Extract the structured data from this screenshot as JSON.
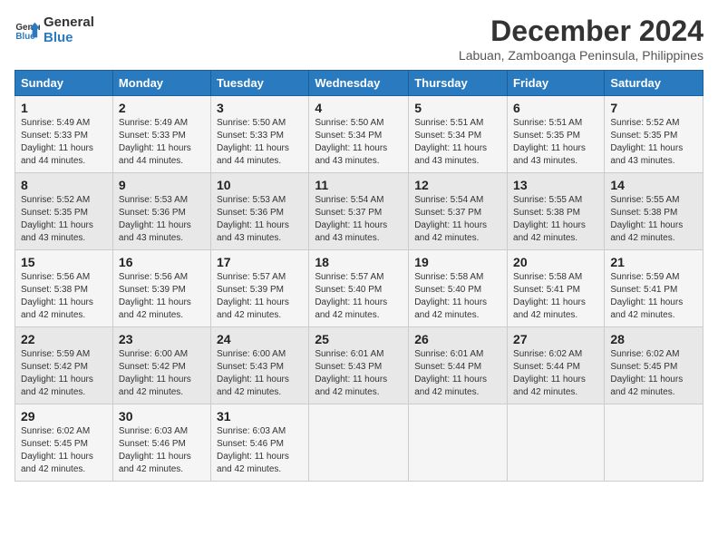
{
  "logo": {
    "line1": "General",
    "line2": "Blue"
  },
  "title": "December 2024",
  "subtitle": "Labuan, Zamboanga Peninsula, Philippines",
  "days_of_week": [
    "Sunday",
    "Monday",
    "Tuesday",
    "Wednesday",
    "Thursday",
    "Friday",
    "Saturday"
  ],
  "weeks": [
    [
      {
        "day": "1",
        "sunrise": "5:49 AM",
        "sunset": "5:33 PM",
        "daylight": "11 hours and 44 minutes."
      },
      {
        "day": "2",
        "sunrise": "5:49 AM",
        "sunset": "5:33 PM",
        "daylight": "11 hours and 44 minutes."
      },
      {
        "day": "3",
        "sunrise": "5:50 AM",
        "sunset": "5:33 PM",
        "daylight": "11 hours and 44 minutes."
      },
      {
        "day": "4",
        "sunrise": "5:50 AM",
        "sunset": "5:34 PM",
        "daylight": "11 hours and 43 minutes."
      },
      {
        "day": "5",
        "sunrise": "5:51 AM",
        "sunset": "5:34 PM",
        "daylight": "11 hours and 43 minutes."
      },
      {
        "day": "6",
        "sunrise": "5:51 AM",
        "sunset": "5:35 PM",
        "daylight": "11 hours and 43 minutes."
      },
      {
        "day": "7",
        "sunrise": "5:52 AM",
        "sunset": "5:35 PM",
        "daylight": "11 hours and 43 minutes."
      }
    ],
    [
      {
        "day": "8",
        "sunrise": "5:52 AM",
        "sunset": "5:35 PM",
        "daylight": "11 hours and 43 minutes."
      },
      {
        "day": "9",
        "sunrise": "5:53 AM",
        "sunset": "5:36 PM",
        "daylight": "11 hours and 43 minutes."
      },
      {
        "day": "10",
        "sunrise": "5:53 AM",
        "sunset": "5:36 PM",
        "daylight": "11 hours and 43 minutes."
      },
      {
        "day": "11",
        "sunrise": "5:54 AM",
        "sunset": "5:37 PM",
        "daylight": "11 hours and 43 minutes."
      },
      {
        "day": "12",
        "sunrise": "5:54 AM",
        "sunset": "5:37 PM",
        "daylight": "11 hours and 42 minutes."
      },
      {
        "day": "13",
        "sunrise": "5:55 AM",
        "sunset": "5:38 PM",
        "daylight": "11 hours and 42 minutes."
      },
      {
        "day": "14",
        "sunrise": "5:55 AM",
        "sunset": "5:38 PM",
        "daylight": "11 hours and 42 minutes."
      }
    ],
    [
      {
        "day": "15",
        "sunrise": "5:56 AM",
        "sunset": "5:38 PM",
        "daylight": "11 hours and 42 minutes."
      },
      {
        "day": "16",
        "sunrise": "5:56 AM",
        "sunset": "5:39 PM",
        "daylight": "11 hours and 42 minutes."
      },
      {
        "day": "17",
        "sunrise": "5:57 AM",
        "sunset": "5:39 PM",
        "daylight": "11 hours and 42 minutes."
      },
      {
        "day": "18",
        "sunrise": "5:57 AM",
        "sunset": "5:40 PM",
        "daylight": "11 hours and 42 minutes."
      },
      {
        "day": "19",
        "sunrise": "5:58 AM",
        "sunset": "5:40 PM",
        "daylight": "11 hours and 42 minutes."
      },
      {
        "day": "20",
        "sunrise": "5:58 AM",
        "sunset": "5:41 PM",
        "daylight": "11 hours and 42 minutes."
      },
      {
        "day": "21",
        "sunrise": "5:59 AM",
        "sunset": "5:41 PM",
        "daylight": "11 hours and 42 minutes."
      }
    ],
    [
      {
        "day": "22",
        "sunrise": "5:59 AM",
        "sunset": "5:42 PM",
        "daylight": "11 hours and 42 minutes."
      },
      {
        "day": "23",
        "sunrise": "6:00 AM",
        "sunset": "5:42 PM",
        "daylight": "11 hours and 42 minutes."
      },
      {
        "day": "24",
        "sunrise": "6:00 AM",
        "sunset": "5:43 PM",
        "daylight": "11 hours and 42 minutes."
      },
      {
        "day": "25",
        "sunrise": "6:01 AM",
        "sunset": "5:43 PM",
        "daylight": "11 hours and 42 minutes."
      },
      {
        "day": "26",
        "sunrise": "6:01 AM",
        "sunset": "5:44 PM",
        "daylight": "11 hours and 42 minutes."
      },
      {
        "day": "27",
        "sunrise": "6:02 AM",
        "sunset": "5:44 PM",
        "daylight": "11 hours and 42 minutes."
      },
      {
        "day": "28",
        "sunrise": "6:02 AM",
        "sunset": "5:45 PM",
        "daylight": "11 hours and 42 minutes."
      }
    ],
    [
      {
        "day": "29",
        "sunrise": "6:02 AM",
        "sunset": "5:45 PM",
        "daylight": "11 hours and 42 minutes."
      },
      {
        "day": "30",
        "sunrise": "6:03 AM",
        "sunset": "5:46 PM",
        "daylight": "11 hours and 42 minutes."
      },
      {
        "day": "31",
        "sunrise": "6:03 AM",
        "sunset": "5:46 PM",
        "daylight": "11 hours and 42 minutes."
      },
      null,
      null,
      null,
      null
    ]
  ]
}
